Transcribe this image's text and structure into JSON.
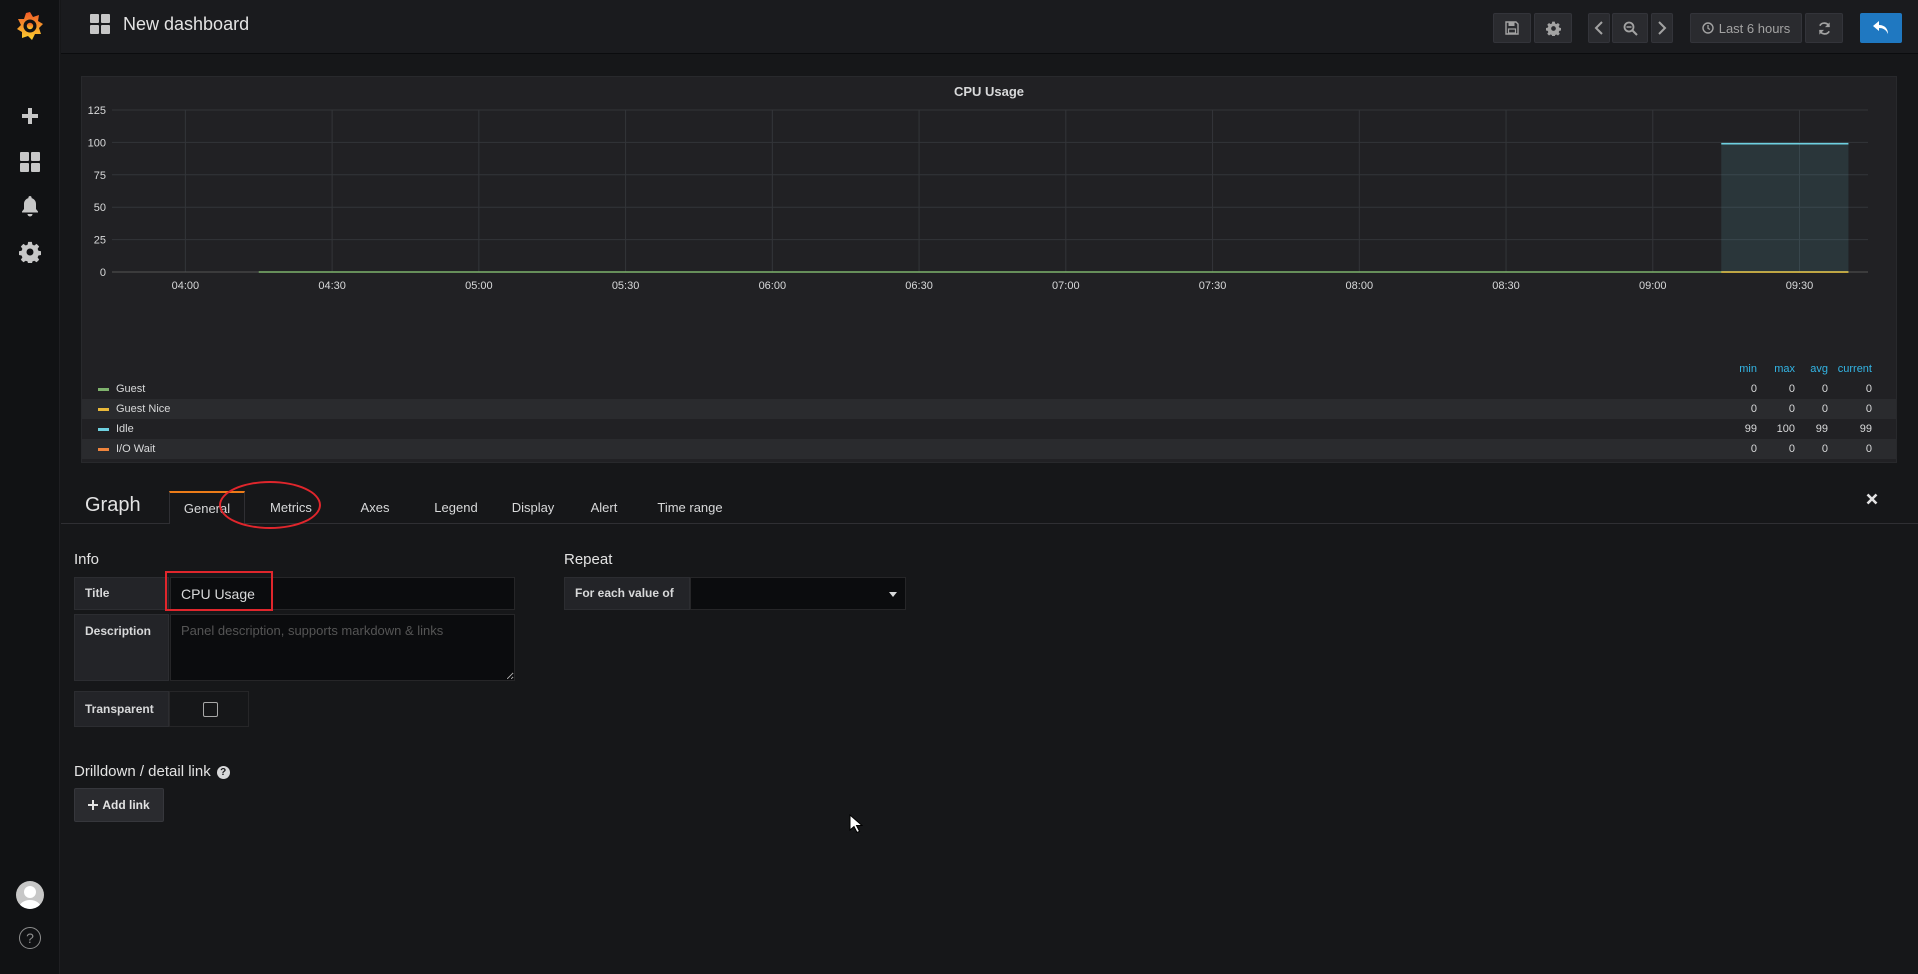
{
  "topbar": {
    "dashboard_title": "New dashboard",
    "time_picker_label": "Last 6 hours"
  },
  "panel": {
    "title": "CPU Usage"
  },
  "chart_data": {
    "type": "line",
    "title": "CPU Usage",
    "xlabel": "",
    "ylabel": "",
    "x_ticks": [
      "04:00",
      "04:30",
      "05:00",
      "05:30",
      "06:00",
      "06:30",
      "07:00",
      "07:30",
      "08:00",
      "08:30",
      "09:00",
      "09:30"
    ],
    "y_ticks": [
      0,
      25,
      50,
      75,
      100,
      125
    ],
    "ylim": [
      0,
      125
    ],
    "xlim_minutes": [
      -15,
      344
    ],
    "grid": true,
    "legend_placement": "bottom",
    "legend_columns": [
      "min",
      "max",
      "avg",
      "current"
    ],
    "series": [
      {
        "name": "Guest",
        "color": "#7eb26d",
        "min": "0",
        "max": "0",
        "avg": "0",
        "current": "0",
        "x": [
          15,
          340
        ],
        "y": [
          0,
          0
        ]
      },
      {
        "name": "Guest Nice",
        "color": "#eab839",
        "min": "0",
        "max": "0",
        "avg": "0",
        "current": "0",
        "x": [
          314,
          340
        ],
        "y": [
          0,
          0
        ]
      },
      {
        "name": "Idle",
        "color": "#6ed0e0",
        "min": "99",
        "max": "100",
        "avg": "99",
        "current": "99",
        "x": [
          314,
          340
        ],
        "y": [
          99,
          99
        ]
      },
      {
        "name": "I/O Wait",
        "color": "#ef843c",
        "min": "0",
        "max": "0",
        "avg": "0",
        "current": "0",
        "x": [],
        "y": []
      }
    ]
  },
  "editor": {
    "panel_type": "Graph",
    "tabs": [
      {
        "label": "General"
      },
      {
        "label": "Metrics"
      },
      {
        "label": "Axes"
      },
      {
        "label": "Legend"
      },
      {
        "label": "Display"
      },
      {
        "label": "Alert"
      },
      {
        "label": "Time range"
      }
    ],
    "info": {
      "heading": "Info",
      "title_label": "Title",
      "title_value": "CPU Usage",
      "description_label": "Description",
      "description_placeholder": "Panel description, supports markdown & links",
      "transparent_label": "Transparent"
    },
    "repeat": {
      "heading": "Repeat",
      "for_each_label": "For each value of",
      "for_each_value": ""
    },
    "drilldown": {
      "heading": "Drilldown / detail link",
      "add_link_label": "Add link"
    }
  },
  "icons": {
    "logo": "grafana-logo-icon",
    "sidebar": [
      "plus-icon",
      "dashboards-icon",
      "bell-icon",
      "gear-icon",
      "avatar",
      "help-icon"
    ],
    "topbar": [
      "save-icon",
      "settings-icon",
      "chevron-left-icon",
      "zoom-out-icon",
      "chevron-right-icon",
      "clock-icon",
      "refresh-icon",
      "back-arrow-icon"
    ]
  },
  "colors": {
    "accent": "#eb7b18",
    "primary_button": "#1f78c1",
    "annotation": "#e0262c",
    "legend_header": "#33b5e5"
  }
}
